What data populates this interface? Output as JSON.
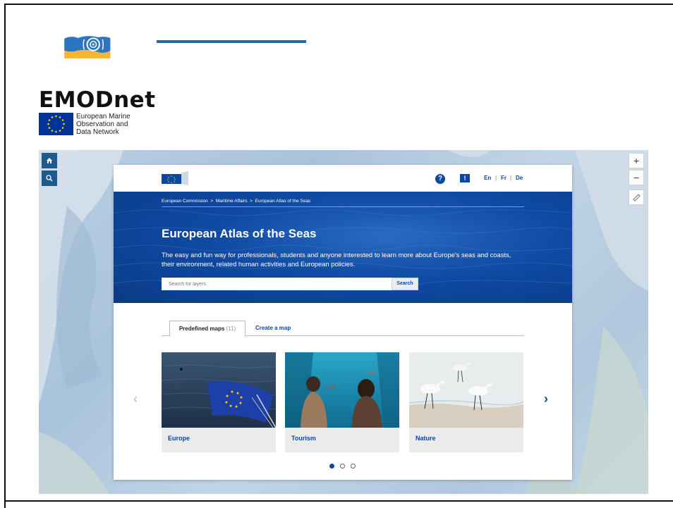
{
  "branding": {
    "name": "EMODnet",
    "subtitle_lines": [
      "European Marine",
      "Observation and",
      "Data Network"
    ]
  },
  "colors": {
    "eu_blue": "#003399",
    "ec_blue": "#0e47a1",
    "accent_bar": "#1f6aa8",
    "logo_yellow": "#f7b533",
    "logo_blue": "#2a77c0"
  },
  "map_controls": {
    "home_icon": "home-icon",
    "search_icon": "search-icon",
    "zoom_in": "+",
    "zoom_out": "−",
    "ruler_icon": "ruler-icon"
  },
  "site_header": {
    "help_icon": "question-icon",
    "help_glyph": "?",
    "feedback_icon": "feedback-icon",
    "feedback_glyph": "!",
    "languages": [
      "En",
      "Fr",
      "De"
    ],
    "lang_separator": "|"
  },
  "breadcrumb": {
    "items": [
      "European Commission",
      "Maritime Affairs",
      "European Atlas of the Seas"
    ],
    "separator": ">"
  },
  "hero": {
    "title": "European Atlas of the Seas",
    "description": "The easy and fun way for professionals, students and anyone interested to learn more about Europe's seas and coasts, their environment, related human activities and European policies.",
    "search_placeholder": "Search for layers",
    "search_button": "Search"
  },
  "tabs": {
    "predefined_label": "Predefined maps",
    "predefined_count": "(11)",
    "create_label": "Create a map"
  },
  "cards": [
    {
      "label": "Europe"
    },
    {
      "label": "Tourism"
    },
    {
      "label": "Nature"
    }
  ],
  "carousel": {
    "prev_glyph": "‹",
    "next_glyph": "›",
    "pages": 3,
    "active_page": 1
  }
}
